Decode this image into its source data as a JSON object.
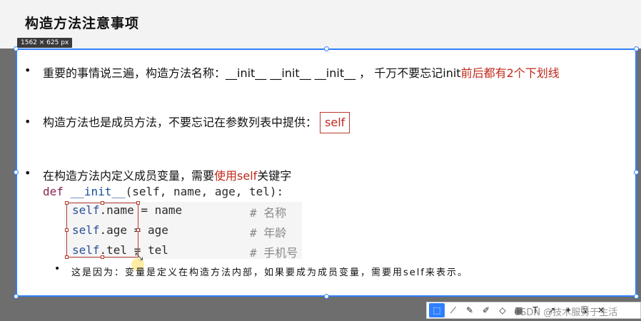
{
  "slide": {
    "title": "构造方法注意事项",
    "bullets": [
      {
        "text_a": "重要的事情说三遍，构造方法名称：__init__ __init__ __init__ ， 千万不要忘记init",
        "text_b": "前后都有2个下划线"
      },
      {
        "text_a": "构造方法也是成员方法，不要忘记在参数列表中提供：",
        "box": "self"
      },
      {
        "text_a": "在构造方法内定义成员变量，需要",
        "text_b": "使用self",
        "text_c": "关键字"
      }
    ],
    "code": {
      "line1_kw": "def",
      "line1_fn": "__init__",
      "line1_rest": "(self, name, age, tel):",
      "lines": [
        {
          "self": "self",
          "rest": ".name = name",
          "comment": "# 名称"
        },
        {
          "self": "self",
          "rest": ".age = age",
          "comment": "# 年龄"
        },
        {
          "self": "self",
          "rest": ".tel = tel",
          "comment": "# 手机号"
        }
      ]
    },
    "note": "这是因为：变量是定义在构造方法内部，如果要成为成员变量，需要用self来表示。"
  },
  "selection": {
    "size_label": "1562 × 625  px"
  },
  "toolbar": {
    "tools": [
      "select-icon",
      "polyline-icon",
      "pen-icon",
      "marker-icon",
      "eraser-icon",
      "mosaic-icon",
      "text-icon",
      "arrow-icon",
      "pin-icon",
      "save-icon",
      "close-icon"
    ]
  },
  "watermark": "CSDN @技术服务于生活",
  "colors": {
    "accent": "#2f7fff",
    "emphasis": "#c0281a"
  }
}
